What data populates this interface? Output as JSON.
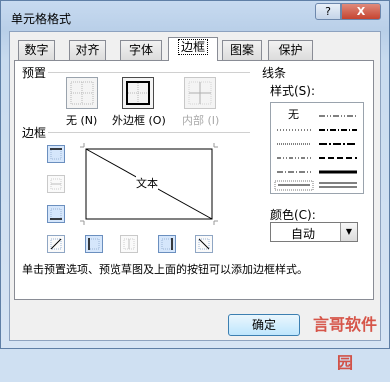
{
  "window": {
    "title": "单元格格式",
    "help_label": "?",
    "close_label": "X"
  },
  "tabs": [
    {
      "label": "数字"
    },
    {
      "label": "对齐"
    },
    {
      "label": "字体"
    },
    {
      "label": "边框",
      "active": true
    },
    {
      "label": "图案"
    },
    {
      "label": "保护"
    }
  ],
  "presets": {
    "heading": "预置",
    "items": [
      {
        "label": "无 (N)",
        "icon": "no-border-icon"
      },
      {
        "label": "外边框 (O)",
        "icon": "outline-border-icon"
      },
      {
        "label": "内部 (I)",
        "icon": "inside-border-icon",
        "disabled": true
      }
    ]
  },
  "border": {
    "heading": "边框",
    "preview_text": "文本",
    "buttons": [
      "top-border-icon",
      "inside-horizontal-border-icon",
      "bottom-border-icon",
      "diagonal-up-border-icon",
      "left-border-icon",
      "inside-vertical-border-icon",
      "right-border-icon",
      "diagonal-down-border-icon"
    ]
  },
  "line": {
    "heading": "线条",
    "style_label": "样式(S):",
    "none_label": "无",
    "color_label": "颜色(C):",
    "color_value": "自动"
  },
  "description": "单击预置选项、预览草图及上面的按钮可以添加边框样式。",
  "buttons": {
    "ok_label": "确定"
  },
  "watermark": {
    "text": "言哥软件园"
  }
}
